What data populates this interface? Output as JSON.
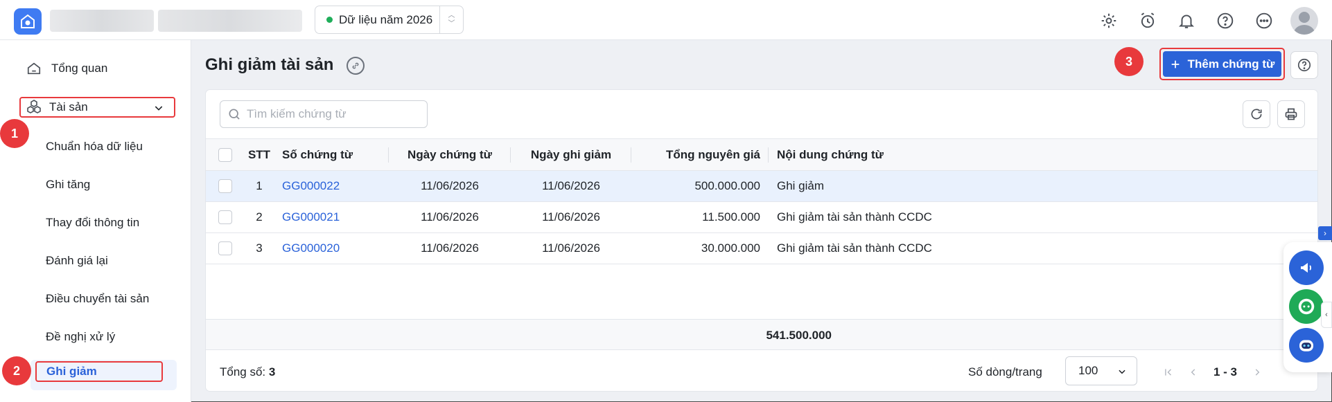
{
  "topbar": {
    "year_label": "Dữ liệu năm 2026"
  },
  "sidebar": {
    "overview": "Tổng quan",
    "group": "Tài sản",
    "items": [
      {
        "label": "Chuẩn hóa dữ liệu"
      },
      {
        "label": "Ghi tăng"
      },
      {
        "label": "Thay đổi thông tin"
      },
      {
        "label": "Đánh giá lại"
      },
      {
        "label": "Điều chuyển tài sản"
      },
      {
        "label": "Đề nghị xử lý"
      }
    ],
    "active": "Ghi giảm"
  },
  "badges": {
    "b1": "1",
    "b2": "2",
    "b3": "3"
  },
  "page": {
    "title": "Ghi giảm tài sản",
    "add_button": "Thêm chứng từ"
  },
  "search": {
    "placeholder": "Tìm kiếm chứng từ"
  },
  "table": {
    "headers": {
      "stt": "STT",
      "so": "Số chứng từ",
      "ngay_ct": "Ngày chứng từ",
      "ngay_gg": "Ngày ghi giảm",
      "tong": "Tổng nguyên giá",
      "noidung": "Nội dung chứng từ"
    },
    "rows": [
      {
        "stt": "1",
        "so": "GG000022",
        "ngay_ct": "11/06/2026",
        "ngay_gg": "11/06/2026",
        "tong": "500.000.000",
        "noidung": "Ghi giảm"
      },
      {
        "stt": "2",
        "so": "GG000021",
        "ngay_ct": "11/06/2026",
        "ngay_gg": "11/06/2026",
        "tong": "11.500.000",
        "noidung": "Ghi giảm tài sản thành CCDC"
      },
      {
        "stt": "3",
        "so": "GG000020",
        "ngay_ct": "11/06/2026",
        "ngay_gg": "11/06/2026",
        "tong": "30.000.000",
        "noidung": "Ghi giảm tài sản thành CCDC"
      }
    ],
    "total": "541.500.000"
  },
  "footer": {
    "count_label": "Tổng số:",
    "count": "3",
    "rows_label": "Số dòng/trang",
    "rows_value": "100",
    "range": "1 - 3"
  },
  "colors": {
    "accent": "#2b63d8",
    "highlight": "#e8393c",
    "link": "#2a62d9"
  }
}
